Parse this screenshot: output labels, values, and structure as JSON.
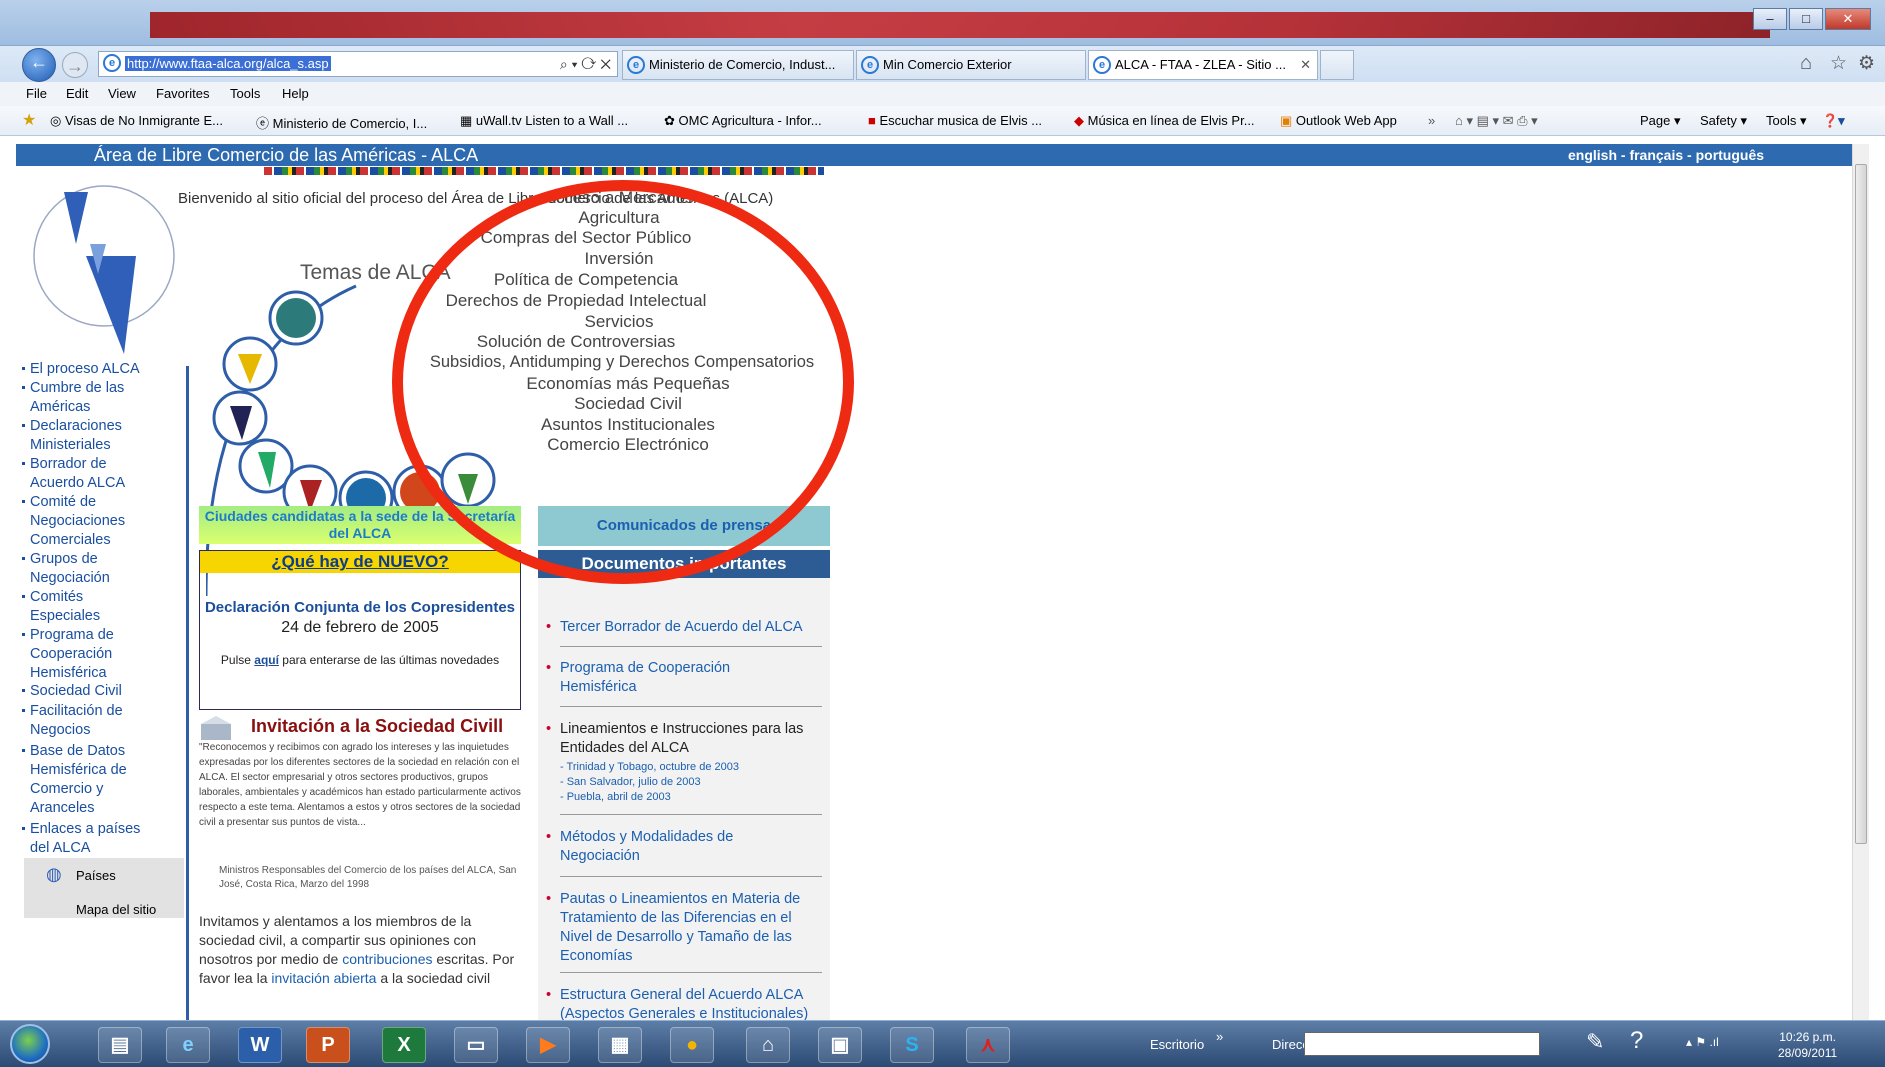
{
  "browser": {
    "url": "http://www.ftaa-alca.org/alca_s.asp",
    "tabs": [
      {
        "label": "Ministerio de Comercio, Indust..."
      },
      {
        "label": "Min Comercio Exterior"
      },
      {
        "label": "ALCA - FTAA - ZLEA - Sitio ..."
      }
    ],
    "menu": [
      "File",
      "Edit",
      "View",
      "Favorites",
      "Tools",
      "Help"
    ],
    "favorites": [
      "Visas de No Inmigrante E...",
      "Ministerio de Comercio, I...",
      "uWall.tv  Listen to a Wall ...",
      "OMC  Agricultura - Infor...",
      "Escuchar musica de Elvis ...",
      "Música en línea de Elvis Pr...",
      "Outlook Web App"
    ],
    "commands": [
      "Page ▾",
      "Safety ▾",
      "Tools ▾"
    ]
  },
  "site": {
    "title": "Área de Libre Comercio de las Américas - ALCA",
    "languages": "english - français - português",
    "welcome": "Bienvenido al sitio oficial del proceso del Área de Libre Comercio de las Américas (ALCA)",
    "temas_label": "Temas de ALCA",
    "topics": [
      "Acceso a Mercados",
      "Agricultura",
      "Compras del Sector Público",
      "Inversión",
      "Política de Competencia",
      "Derechos de Propiedad Intelectual",
      "Servicios",
      "Solución de Controversias",
      "Subsidios, Antidumping y Derechos Compensatorios",
      "Economías más Pequeñas",
      "Sociedad Civil",
      "Asuntos Institucionales",
      "Comercio Electrónico"
    ],
    "sidenav": [
      "El proceso ALCA",
      "Cumbre de las Américas",
      "Declaraciones Ministeriales",
      "Borrador de Acuerdo ALCA",
      "Comité de Negociaciones Comerciales",
      "Grupos de Negociación",
      "Comités Especiales",
      "Programa de Cooperación Hemisférica",
      "Sociedad Civil",
      "Facilitación de Negocios",
      "Base de Datos Hemisférica de Comercio y Aranceles",
      "Enlaces a países del ALCA"
    ],
    "paises": "Países",
    "mapa": "Mapa del sitio",
    "ciudades": "Ciudades candidatas a la sede de la Secretaría del ALCA",
    "nuevo_title": "¿Qué hay de NUEVO?",
    "nuevo_decl": "Declaración Conjunta de los Copresidentes",
    "nuevo_date": "24 de febrero de 2005",
    "nuevo_pulse": "Pulse",
    "nuevo_aqui": "aquí",
    "nuevo_rest": "para enterarse de las últimas novedades",
    "invit_title": "Invitación a la Sociedad Civill",
    "invit_quote": "\"Reconocemos y recibimos con agrado los intereses y las inquietudes expresadas por los diferentes sectores de la sociedad en relación con el ALCA. El sector empresarial y otros sectores productivos, grupos laborales, ambientales y académicos han estado particularmente activos respecto a este tema. Alentamos a estos y otros sectores de la sociedad civil a presentar sus puntos de vista...",
    "invit_source": "Ministros Responsables del Comercio de los países del ALCA, San José, Costa Rica, Marzo del 1998",
    "invit_body1": "Invitamos y alentamos a los miembros de la sociedad civil, a compartir sus opiniones con nosotros por medio de",
    "invit_link1": "contribuciones",
    "invit_body2": "escritas. Por favor lea la",
    "invit_link2": "invitación abierta",
    "invit_body3": "a la sociedad civil",
    "comunicados": "Comunicados de prensa",
    "documentos": "Documentos importantes",
    "docs": [
      "Tercer Borrador de Acuerdo del ALCA",
      "Programa de Cooperación Hemisférica",
      "Lineamientos e Instrucciones para las Entidades del ALCA",
      "Métodos y Modalidades de Negociación",
      "Pautas o Lineamientos en Materia de Tratamiento de las Diferencias en el Nivel de Desarrollo y Tamaño de las Economías",
      "Estructura General del Acuerdo ALCA (Aspectos Generales e Institucionales)"
    ],
    "doc_subs": [
      "- Trinidad y Tobago, octubre de 2003",
      "- San Salvador, julio de 2003",
      "- Puebla, abril de 2003"
    ]
  },
  "taskbar": {
    "escritorio": "Escritorio",
    "direccion": "Dirección",
    "time": "10:26 p.m.",
    "date": "28/09/2011"
  },
  "colors": {
    "annotation": "#ee2a12",
    "header": "#2e6ab0",
    "link": "#1a4fa0"
  }
}
